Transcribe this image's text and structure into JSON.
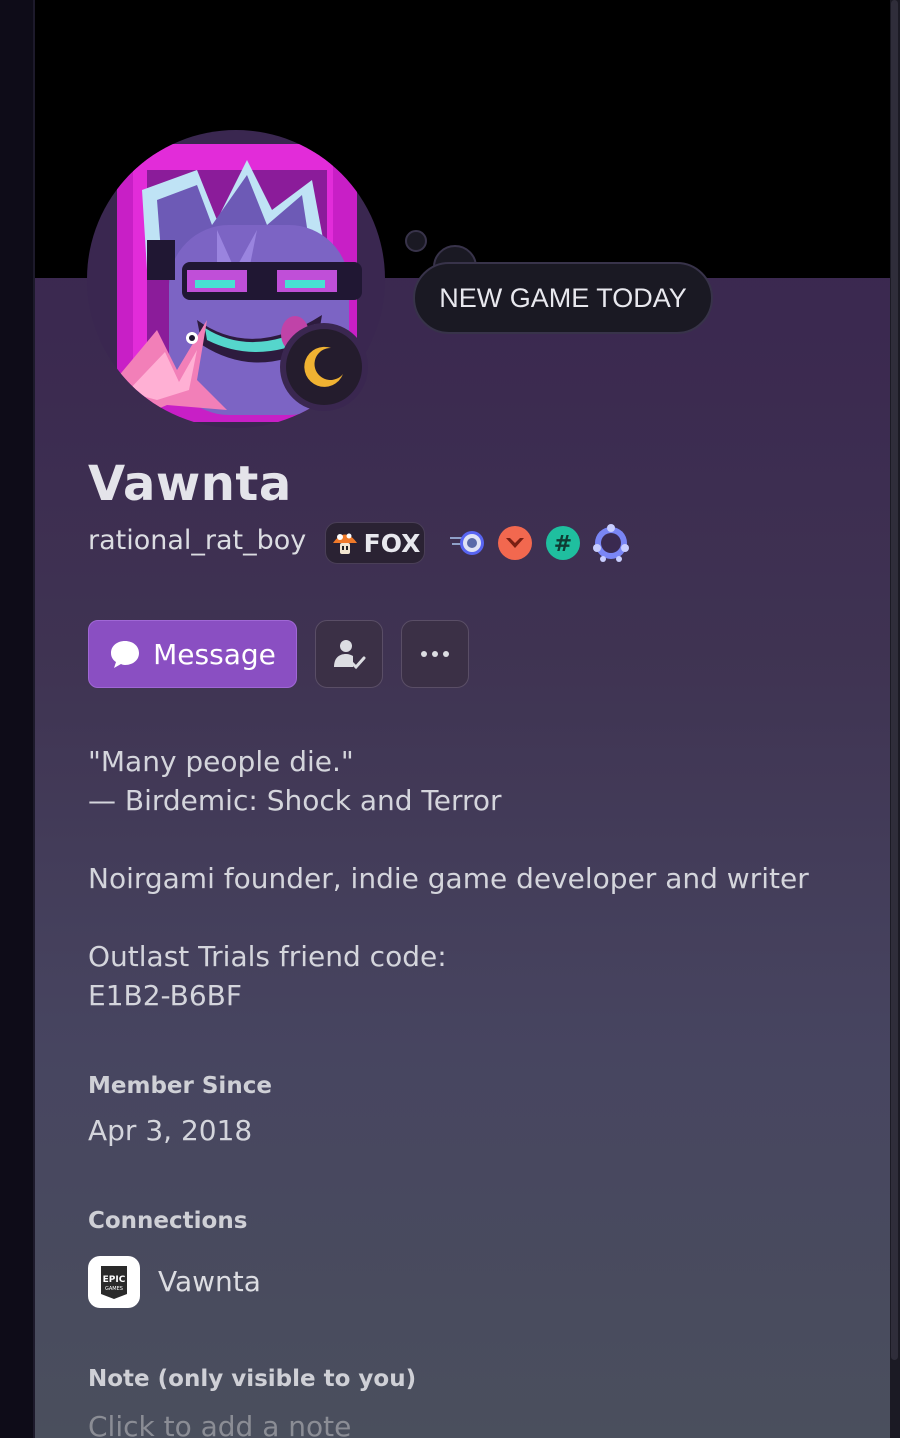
{
  "profile": {
    "custom_status": "NEW GAME TODAY",
    "display_name": "Vawnta",
    "username": "rational_rat_boy",
    "guild_tag": "FOX",
    "status": "idle",
    "badges": [
      "speedboost-badge-icon",
      "quest-badge-icon",
      "hashtag-badge-icon",
      "hypesquad-badge-icon"
    ]
  },
  "actions": {
    "message_label": "Message",
    "friend_icon": "user-check-icon",
    "more_icon": "more-horizontal-icon"
  },
  "bio": {
    "lines": [
      "\"Many people die.\"",
      "— Birdemic: Shock and Terror",
      "",
      "Noirgami founder, indie game developer and writer",
      "",
      "Outlast Trials friend code:",
      "E1B2-B6BF"
    ]
  },
  "member_since": {
    "label": "Member Since",
    "date": "Apr 3, 2018"
  },
  "connections": {
    "label": "Connections",
    "items": [
      {
        "platform_icon": "epic-games-icon",
        "name": "Vawnta"
      }
    ]
  },
  "note": {
    "label": "Note (only visible to you)",
    "placeholder": "Click to add a note"
  },
  "colors": {
    "accent": "#8a4fc2",
    "banner": "#000000",
    "idle": "#f0b232"
  }
}
